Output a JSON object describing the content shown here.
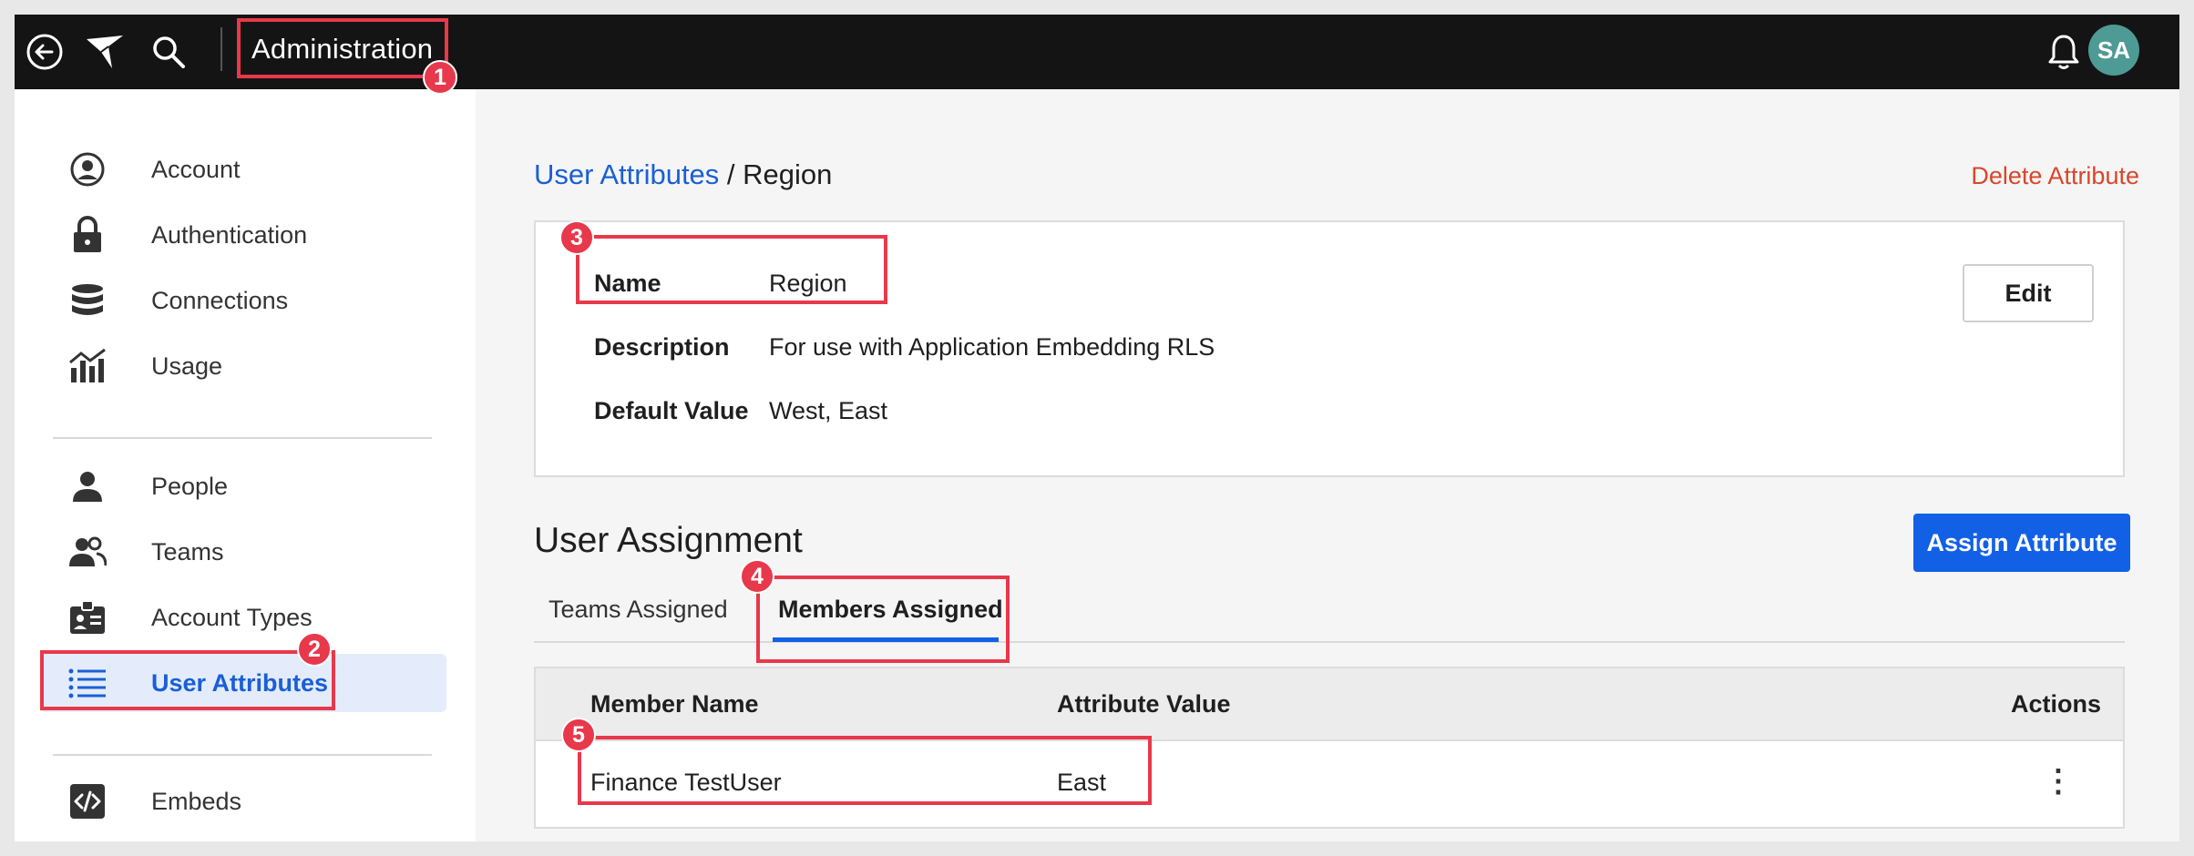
{
  "topbar": {
    "title": "Administration",
    "back_icon": "back-arrow-icon",
    "logo_icon": "app-logo-icon",
    "search_icon": "search-icon",
    "bell_icon": "bell-icon",
    "avatar_initials": "SA",
    "avatar_color": "#4e9a94"
  },
  "sidebar": {
    "items": [
      {
        "label": "Account",
        "icon": "account-circle-icon"
      },
      {
        "label": "Authentication",
        "icon": "lock-icon"
      },
      {
        "label": "Connections",
        "icon": "database-icon"
      },
      {
        "label": "Usage",
        "icon": "usage-chart-icon"
      },
      {
        "label": "People",
        "icon": "person-icon"
      },
      {
        "label": "Teams",
        "icon": "team-icon"
      },
      {
        "label": "Account Types",
        "icon": "id-badge-icon"
      },
      {
        "label": "User Attributes",
        "icon": "list-icon"
      },
      {
        "label": "Embeds",
        "icon": "code-icon"
      }
    ],
    "active_index": 7,
    "accent_color": "#1a5fd6"
  },
  "breadcrumb": {
    "parent": "User Attributes",
    "separator": " / ",
    "current": "Region"
  },
  "delete_label": "Delete Attribute",
  "details": {
    "name_key": "Name",
    "name_value": "Region",
    "description_key": "Description",
    "description_value": "For use with Application Embedding RLS",
    "default_key": "Default Value",
    "default_value": "West, East",
    "edit_label": "Edit"
  },
  "assignment": {
    "title": "User Assignment",
    "assign_button": "Assign Attribute",
    "tabs": [
      "Teams Assigned",
      "Members Assigned"
    ],
    "active_tab": 1,
    "columns": [
      "Member Name",
      "Attribute Value",
      "Actions"
    ],
    "rows": [
      {
        "member": "Finance TestUser",
        "value": "East",
        "actions": "⋮"
      }
    ]
  },
  "callouts": [
    "1",
    "2",
    "3",
    "4",
    "5"
  ],
  "colors": {
    "primary": "#1160e6",
    "danger": "#d8462b",
    "callout": "#e8384b",
    "topbar": "#141414"
  }
}
